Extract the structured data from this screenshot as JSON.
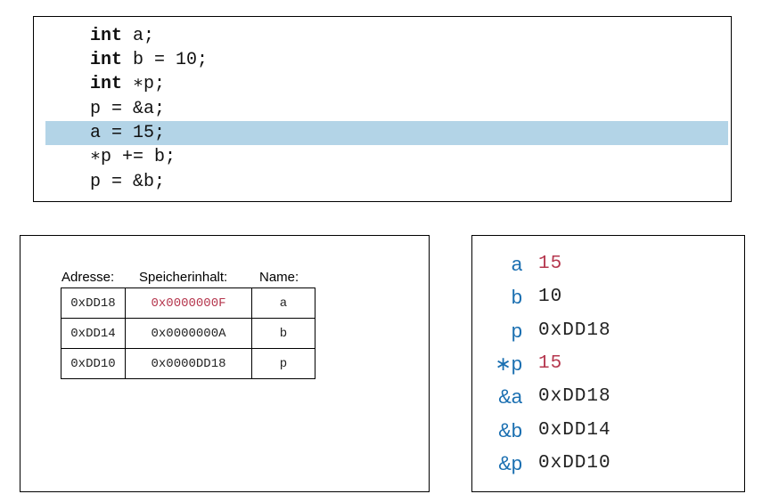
{
  "code": {
    "lines": [
      {
        "kw": "int",
        "rest": " a;",
        "highlight": false
      },
      {
        "kw": "int",
        "rest": " b = 10;",
        "highlight": false
      },
      {
        "kw": "int",
        "rest": " ∗p;",
        "highlight": false
      },
      {
        "kw": "",
        "rest": "p = &a;",
        "highlight": false
      },
      {
        "kw": "",
        "rest": "a = 15;",
        "highlight": true
      },
      {
        "kw": "",
        "rest": "∗p += b;",
        "highlight": false
      },
      {
        "kw": "",
        "rest": "p = &b;",
        "highlight": false
      }
    ],
    "highlight_color": "#b3d4e7"
  },
  "memory": {
    "headers": {
      "address": "Adresse:",
      "content": "Speicherinhalt:",
      "name": "Name:"
    },
    "rows": [
      {
        "address": "0xDD18",
        "content": "0x0000000F",
        "name": "a",
        "changed": true
      },
      {
        "address": "0xDD14",
        "content": "0x0000000A",
        "name": "b",
        "changed": false
      },
      {
        "address": "0xDD10",
        "content": "0x0000DD18",
        "name": "p",
        "changed": false
      }
    ]
  },
  "expressions": [
    {
      "label": "a",
      "value": "15",
      "changed": true
    },
    {
      "label": "b",
      "value": "10",
      "changed": false
    },
    {
      "label": "p",
      "value": "0xDD18",
      "changed": false
    },
    {
      "label": "∗p",
      "value": "15",
      "changed": true
    },
    {
      "label": "&a",
      "value": "0xDD18",
      "changed": false
    },
    {
      "label": "&b",
      "value": "0xDD14",
      "changed": false
    },
    {
      "label": "&p",
      "value": "0xDD10",
      "changed": false
    }
  ],
  "colors": {
    "label_blue": "#1a6fb1",
    "changed_red": "#b5364d"
  }
}
